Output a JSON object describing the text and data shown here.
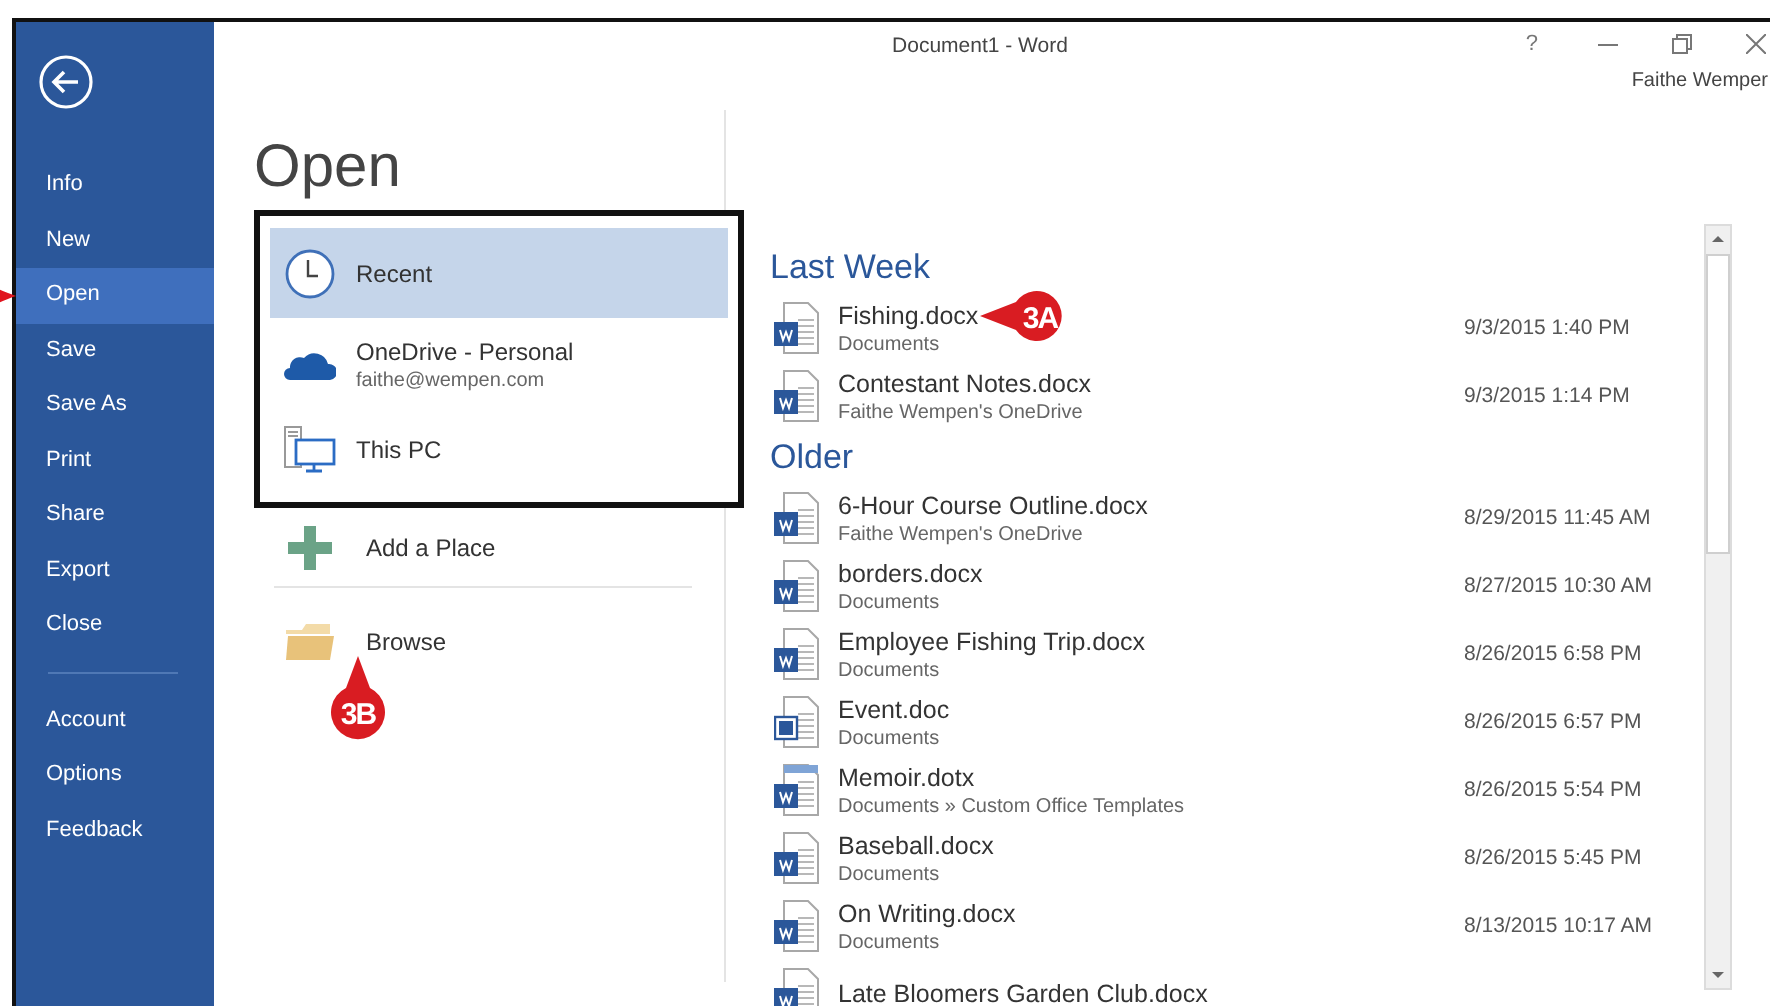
{
  "window": {
    "title": "Document1 - Word",
    "help": "?",
    "account": "Faithe Wemper"
  },
  "sidebar": {
    "items": [
      {
        "label": "Info",
        "selected": false
      },
      {
        "label": "New",
        "selected": false
      },
      {
        "label": "Open",
        "selected": true,
        "pointed": true
      },
      {
        "label": "Save",
        "selected": false
      },
      {
        "label": "Save As",
        "selected": false
      },
      {
        "label": "Print",
        "selected": false
      },
      {
        "label": "Share",
        "selected": false
      },
      {
        "label": "Export",
        "selected": false
      },
      {
        "label": "Close",
        "selected": false
      }
    ],
    "bottom_items": [
      {
        "label": "Account",
        "selected": false
      },
      {
        "label": "Options",
        "selected": false
      },
      {
        "label": "Feedback",
        "selected": false
      }
    ]
  },
  "heading": "Open",
  "places": [
    {
      "kind": "recent",
      "label": "Recent",
      "selected": true
    },
    {
      "kind": "onedrive",
      "label": "OneDrive - Personal",
      "detail": "faithe@wempen.com",
      "selected": false
    },
    {
      "kind": "pc",
      "label": "This PC",
      "selected": false
    }
  ],
  "actions": [
    {
      "kind": "add",
      "label": "Add a Place"
    },
    {
      "kind": "browse",
      "label": "Browse",
      "callout": {
        "label": "3B"
      }
    }
  ],
  "groups": [
    {
      "title": "Last Week",
      "files": [
        {
          "kind": "docx",
          "name": "Fishing.docx",
          "location": "Documents",
          "date": "9/3/2015 1:40 PM",
          "callout": {
            "label": "3A"
          }
        },
        {
          "kind": "docx",
          "name": "Contestant Notes.docx",
          "location": "Faithe Wempen's OneDrive",
          "date": "9/3/2015 1:14 PM"
        }
      ]
    },
    {
      "title": "Older",
      "files": [
        {
          "kind": "docx",
          "name": "6-Hour Course Outline.docx",
          "location": "Faithe Wempen's OneDrive",
          "date": "8/29/2015 11:45 AM"
        },
        {
          "kind": "docx",
          "name": "borders.docx",
          "location": "Documents",
          "date": "8/27/2015 10:30 AM"
        },
        {
          "kind": "docx",
          "name": "Employee Fishing Trip.docx",
          "location": "Documents",
          "date": "8/26/2015 6:58 PM"
        },
        {
          "kind": "doc",
          "name": "Event.doc",
          "location": "Documents",
          "date": "8/26/2015 6:57 PM"
        },
        {
          "kind": "dotx",
          "name": "Memoir.dotx",
          "location": "Documents » Custom Office Templates",
          "date": "8/26/2015 5:54 PM"
        },
        {
          "kind": "docx",
          "name": "Baseball.docx",
          "location": "Documents",
          "date": "8/26/2015 5:45 PM"
        },
        {
          "kind": "docx",
          "name": "On Writing.docx",
          "location": "Documents",
          "date": "8/13/2015 10:17 AM"
        },
        {
          "kind": "docx",
          "name": "Late Bloomers Garden Club.docx"
        }
      ]
    }
  ]
}
